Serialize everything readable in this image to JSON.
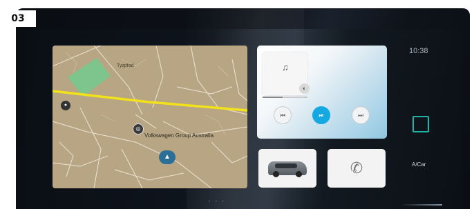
{
  "figure_tag": "03",
  "status": {
    "time": "10:38"
  },
  "map": {
    "town_label": "Tyzpfad",
    "poi_label": "Volkswagen Group Australia",
    "poi_icon": "vw-logo-icon",
    "road_marker": "road-number-icon",
    "position_icon": "navigation-arrow-icon",
    "route_color": "#f2e21b",
    "park_color": "#7ec48d"
  },
  "media": {
    "album_icon": "music-note-icon",
    "source_icon": "media-source-icon",
    "progress": 0.45,
    "controls": {
      "prev_icon": "previous-track-icon",
      "play_icon": "play-pause-icon",
      "next_icon": "next-track-icon"
    },
    "accent_color": "#16a9e1"
  },
  "tiles": {
    "vehicle_icon": "car-icon",
    "phone_icon": "phone-icon"
  },
  "sidebar": {
    "app_icon": "app-square-icon",
    "app_label": "A/Car",
    "app_color": "#1fb5a5"
  },
  "pager": {
    "page_count": 3,
    "active_page": 2
  }
}
